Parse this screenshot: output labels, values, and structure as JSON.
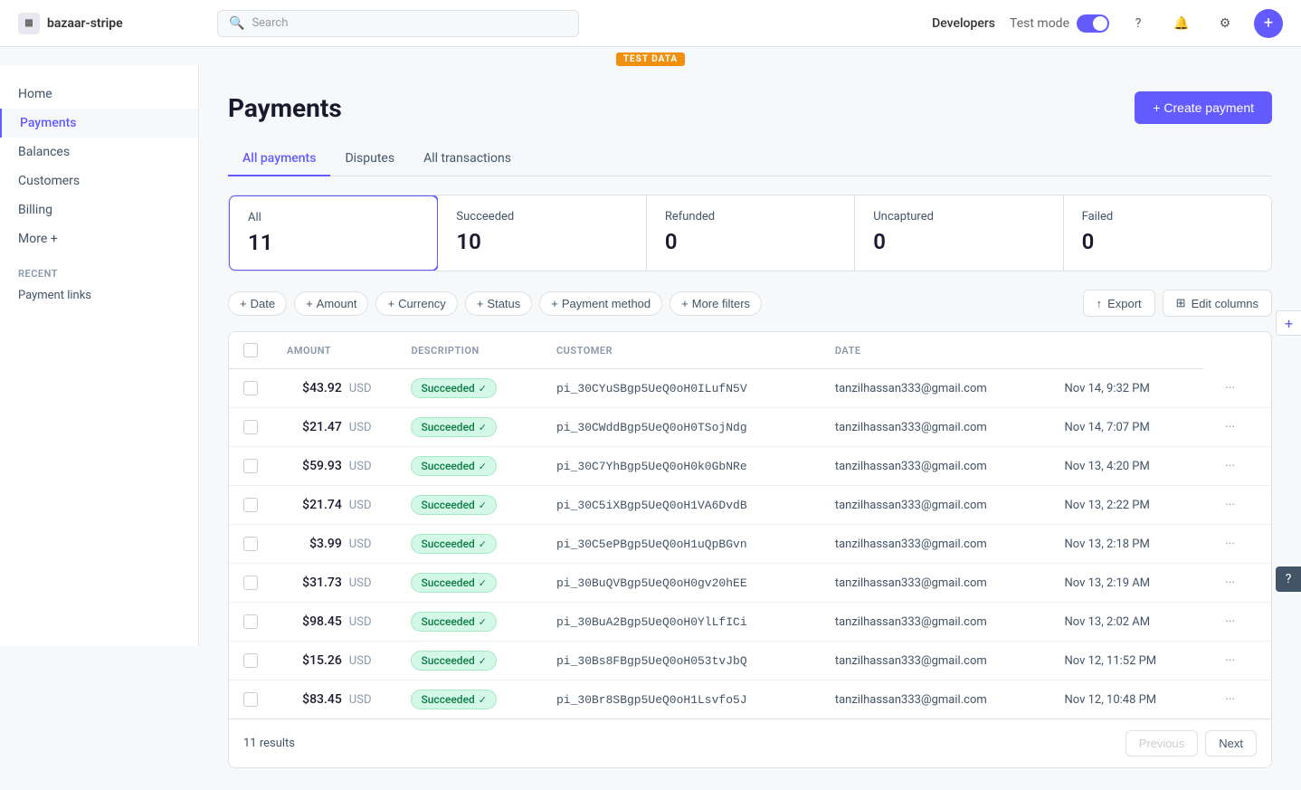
{
  "app": {
    "logo_text": "bazaar-stripe",
    "search_placeholder": "Search"
  },
  "topnav": {
    "developers_label": "Developers",
    "test_mode_label": "Test mode",
    "question_icon": "?",
    "bell_icon": "🔔",
    "gear_icon": "⚙",
    "plus_icon": "+"
  },
  "test_banner": {
    "label": "TEST DATA"
  },
  "sidebar": {
    "items": [
      {
        "label": "Home",
        "active": false
      },
      {
        "label": "Payments",
        "active": true
      },
      {
        "label": "Balances",
        "active": false
      },
      {
        "label": "Customers",
        "active": false
      },
      {
        "label": "Billing",
        "active": false
      },
      {
        "label": "More +",
        "active": false
      }
    ],
    "recent_section": "Recent",
    "recent_items": [
      {
        "label": "Payment links"
      }
    ]
  },
  "page": {
    "title": "Payments",
    "create_button": "+ Create payment"
  },
  "tabs": [
    {
      "label": "All payments",
      "active": true
    },
    {
      "label": "Disputes",
      "active": false
    },
    {
      "label": "All transactions",
      "active": false
    }
  ],
  "stats": [
    {
      "label": "All",
      "value": "11",
      "selected": true
    },
    {
      "label": "Succeeded",
      "value": "10",
      "selected": false
    },
    {
      "label": "Refunded",
      "value": "0",
      "selected": false
    },
    {
      "label": "Uncaptured",
      "value": "0",
      "selected": false
    },
    {
      "label": "Failed",
      "value": "0",
      "selected": false
    }
  ],
  "filters": [
    {
      "label": "Date"
    },
    {
      "label": "Amount"
    },
    {
      "label": "Currency"
    },
    {
      "label": "Status"
    },
    {
      "label": "Payment method"
    },
    {
      "label": "More filters"
    }
  ],
  "actions": [
    {
      "label": "Export",
      "icon": "↑"
    },
    {
      "label": "Edit columns",
      "icon": "⊞"
    }
  ],
  "table": {
    "columns": [
      "",
      "AMOUNT",
      "",
      "DESCRIPTION",
      "CUSTOMER",
      "DATE",
      ""
    ],
    "rows": [
      {
        "amount": "$43.92",
        "currency": "USD",
        "status": "Succeeded",
        "description": "pi_30CYuSBgp5UeQ0oH0ILufN5V",
        "customer": "tanzilhassan333@gmail.com",
        "date": "Nov 14, 9:32 PM"
      },
      {
        "amount": "$21.47",
        "currency": "USD",
        "status": "Succeeded",
        "description": "pi_30CWddBgp5UeQ0oH0TSojNdg",
        "customer": "tanzilhassan333@gmail.com",
        "date": "Nov 14, 7:07 PM"
      },
      {
        "amount": "$59.93",
        "currency": "USD",
        "status": "Succeeded",
        "description": "pi_30C7YhBgp5UeQ0oH0k0GbNRe",
        "customer": "tanzilhassan333@gmail.com",
        "date": "Nov 13, 4:20 PM"
      },
      {
        "amount": "$21.74",
        "currency": "USD",
        "status": "Succeeded",
        "description": "pi_30C5iXBgp5UeQ0oH1VA6DvdB",
        "customer": "tanzilhassan333@gmail.com",
        "date": "Nov 13, 2:22 PM"
      },
      {
        "amount": "$3.99",
        "currency": "USD",
        "status": "Succeeded",
        "description": "pi_30C5ePBgp5UeQ0oH1uQpBGvn",
        "customer": "tanzilhassan333@gmail.com",
        "date": "Nov 13, 2:18 PM"
      },
      {
        "amount": "$31.73",
        "currency": "USD",
        "status": "Succeeded",
        "description": "pi_30BuQVBgp5UeQ0oH0gv20hEE",
        "customer": "tanzilhassan333@gmail.com",
        "date": "Nov 13, 2:19 AM"
      },
      {
        "amount": "$98.45",
        "currency": "USD",
        "status": "Succeeded",
        "description": "pi_30BuA2Bgp5UeQ0oH0YlLfICi",
        "customer": "tanzilhassan333@gmail.com",
        "date": "Nov 13, 2:02 AM"
      },
      {
        "amount": "$15.26",
        "currency": "USD",
        "status": "Succeeded",
        "description": "pi_30Bs8FBgp5UeQ0oH053tvJbQ",
        "customer": "tanzilhassan333@gmail.com",
        "date": "Nov 12, 11:52 PM"
      },
      {
        "amount": "$83.45",
        "currency": "USD",
        "status": "Succeeded",
        "description": "pi_30Br8SBgp5UeQ0oH1Lsvfo5J",
        "customer": "tanzilhassan333@gmail.com",
        "date": "Nov 12, 10:48 PM"
      }
    ]
  },
  "footer": {
    "results": "11 results",
    "previous_btn": "Previous",
    "next_btn": "Next"
  },
  "colors": {
    "accent": "#635bff",
    "success_bg": "#d4f8e8",
    "success_text": "#0a7c42"
  }
}
